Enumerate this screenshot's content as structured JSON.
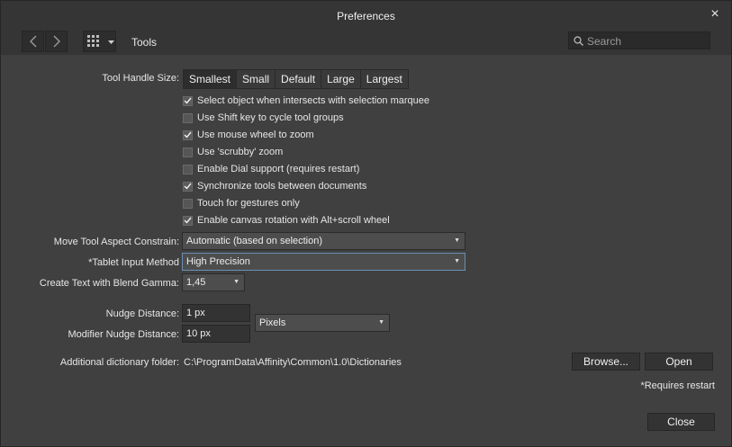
{
  "window": {
    "title": "Preferences",
    "close_icon": "×"
  },
  "toolbar": {
    "back_icon": "<",
    "forward_icon": ">",
    "section": "Tools",
    "search_placeholder": "Search"
  },
  "handle_size": {
    "label": "Tool Handle Size:",
    "options": [
      "Smallest",
      "Small",
      "Default",
      "Large",
      "Largest"
    ],
    "selected": "Smallest"
  },
  "checkboxes": [
    {
      "label": "Select object when intersects with selection marquee",
      "checked": true
    },
    {
      "label": "Use Shift key to cycle tool groups",
      "checked": false
    },
    {
      "label": "Use mouse wheel to zoom",
      "checked": true
    },
    {
      "label": "Use 'scrubby' zoom",
      "checked": false
    },
    {
      "label": "Enable Dial support (requires restart)",
      "checked": false
    },
    {
      "label": "Synchronize tools between documents",
      "checked": true
    },
    {
      "label": "Touch for gestures only",
      "checked": false
    },
    {
      "label": "Enable canvas rotation with Alt+scroll wheel",
      "checked": true
    }
  ],
  "move_aspect": {
    "label": "Move Tool Aspect Constrain:",
    "value": "Automatic (based on selection)"
  },
  "tablet_input": {
    "label": "*Tablet Input Method",
    "value": "High Precision"
  },
  "blend_gamma": {
    "label": "Create Text with Blend Gamma:",
    "value": "1,45"
  },
  "nudge": {
    "label": "Nudge Distance:",
    "value": "1 px"
  },
  "modifier_nudge": {
    "label": "Modifier Nudge Distance:",
    "value": "10 px"
  },
  "units": {
    "value": "Pixels"
  },
  "dictionary": {
    "label": "Additional dictionary folder:",
    "path": "C:\\ProgramData\\Affinity\\Common\\1.0\\Dictionaries",
    "browse_label": "Browse...",
    "open_label": "Open"
  },
  "requires_restart_note": "*Requires restart",
  "close_label": "Close"
}
